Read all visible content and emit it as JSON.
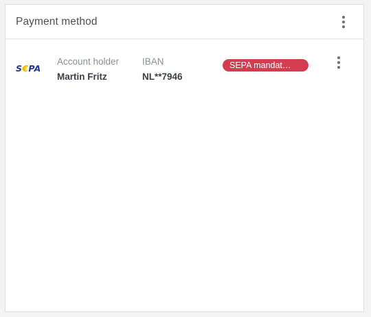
{
  "card": {
    "title": "Payment method",
    "menu_icon": "kebab-menu-icon"
  },
  "payment_method": {
    "logo_text_s": "S",
    "logo_text_euro": "€",
    "logo_text_pa": "PA",
    "account_holder_label": "Account holder",
    "account_holder_value": "Martin Fritz",
    "iban_label": "IBAN",
    "iban_value": "NL**7946",
    "mandate_badge": "SEPA mandat…",
    "row_menu_icon": "kebab-menu-icon"
  },
  "colors": {
    "badge_bg": "#d43c4f",
    "sepa_blue": "#1c3a94",
    "sepa_yellow": "#f2b200"
  }
}
